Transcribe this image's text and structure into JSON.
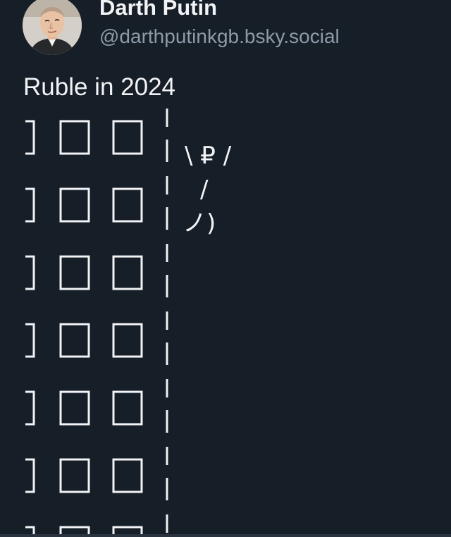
{
  "author": {
    "display_name": "Darth Putin",
    "handle": "@darthputinkgb.bsky.social",
    "avatar_icon": "profile-photo"
  },
  "post": {
    "text": "Ruble in 2024",
    "ascii_art": {
      "figure_lines": [
        "\\ ₽ /",
        "/",
        "ノ)"
      ],
      "row_count": 7
    }
  },
  "colors": {
    "background": "#161e27",
    "text": "#f1f3f5",
    "muted": "#8d9aa8"
  }
}
